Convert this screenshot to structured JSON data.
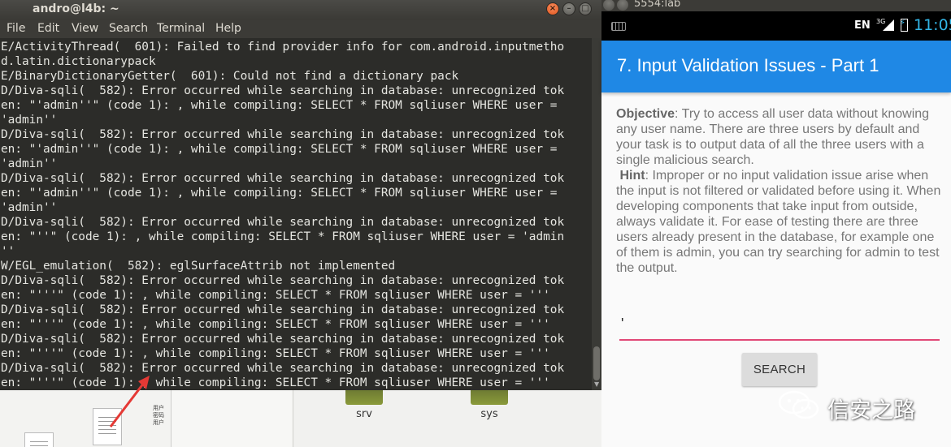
{
  "terminal": {
    "title": "andro@l4b: ~",
    "menu": [
      "File",
      "Edit",
      "View",
      "Search",
      "Terminal",
      "Help"
    ],
    "lines": [
      "E/ActivityThread(  601): Failed to find provider info for com.android.inputmetho",
      "d.latin.dictionarypack",
      "E/BinaryDictionaryGetter(  601): Could not find a dictionary pack",
      "D/Diva-sqli(  582): Error occurred while searching in database: unrecognized tok",
      "en: \"'admin''\" (code 1): , while compiling: SELECT * FROM sqliuser WHERE user =",
      "'admin''",
      "D/Diva-sqli(  582): Error occurred while searching in database: unrecognized tok",
      "en: \"'admin''\" (code 1): , while compiling: SELECT * FROM sqliuser WHERE user =",
      "'admin''",
      "D/Diva-sqli(  582): Error occurred while searching in database: unrecognized tok",
      "en: \"'admin''\" (code 1): , while compiling: SELECT * FROM sqliuser WHERE user =",
      "'admin''",
      "D/Diva-sqli(  582): Error occurred while searching in database: unrecognized tok",
      "en: \"''\" (code 1): , while compiling: SELECT * FROM sqliuser WHERE user = 'admin",
      "''",
      "W/EGL_emulation(  582): eglSurfaceAttrib not implemented",
      "D/Diva-sqli(  582): Error occurred while searching in database: unrecognized tok",
      "en: \"'''\" (code 1): , while compiling: SELECT * FROM sqliuser WHERE user = '''",
      "D/Diva-sqli(  582): Error occurred while searching in database: unrecognized tok",
      "en: \"'''\" (code 1): , while compiling: SELECT * FROM sqliuser WHERE user = '''",
      "D/Diva-sqli(  582): Error occurred while searching in database: unrecognized tok",
      "en: \"'''\" (code 1): , while compiling: SELECT * FROM sqliuser WHERE user = '''",
      "D/Diva-sqli(  582): Error occurred while searching in database: unrecognized tok",
      "en: \"'''\" (code 1): , while compiling: SELECT * FROM sqliuser WHERE user = '''"
    ]
  },
  "desktop": {
    "folders": [
      "srv",
      "sys"
    ]
  },
  "emulator": {
    "title": "5554:lab",
    "status": {
      "lang": "EN",
      "network": "3G",
      "time": "11:05"
    },
    "app_title": "7. Input Validation Issues - Part 1",
    "objective_label": "Objective",
    "objective_text": ": Try to access all user data without knowing any user name. There are three users by default and your task is to output data of all the three users with a single malicious search.",
    "hint_label": "Hint",
    "hint_text": ": Improper or no input validation issue arise when the input is not filtered or validated before using it. When developing components that take input from outside, always validate it. For ease of testing there are three users already present in the database, for example one of them is admin, you can try searching for admin to test the output.",
    "search_value": "'",
    "search_button": "SEARCH"
  },
  "watermark": {
    "text": "信安之路"
  },
  "colors": {
    "appbar": "#1f88e5",
    "accent": "#e14876",
    "terminal_bg": "#2c2c29",
    "clock": "#33b5e5"
  }
}
